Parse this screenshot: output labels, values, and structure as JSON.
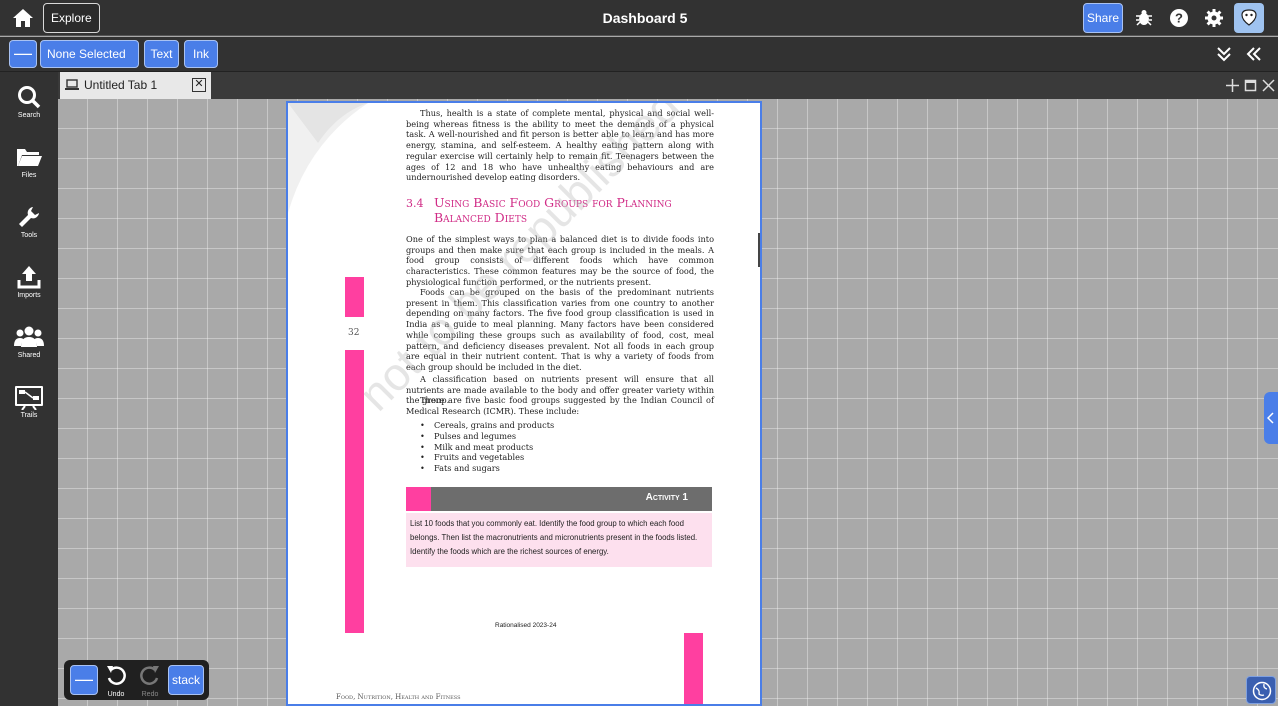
{
  "topbar": {
    "explore_label": "Explore",
    "title": "Dashboard 5",
    "share_label": "Share",
    "icons": [
      "home-icon",
      "bug-icon",
      "help-icon",
      "gear-icon",
      "avatar-icon"
    ]
  },
  "toolbar": {
    "minus_label": "—",
    "selection_label": "None Selected",
    "text_label": "Text",
    "ink_label": "Ink"
  },
  "sidebar": {
    "items": [
      {
        "label": "Search",
        "icon": "search-icon"
      },
      {
        "label": "Files",
        "icon": "folder-icon"
      },
      {
        "label": "Tools",
        "icon": "wrench-icon"
      },
      {
        "label": "Imports",
        "icon": "upload-icon"
      },
      {
        "label": "Shared",
        "icon": "users-icon"
      },
      {
        "label": "Trails",
        "icon": "trails-icon"
      }
    ]
  },
  "tabs": [
    {
      "label": "Untitled Tab 1",
      "close": "✕"
    }
  ],
  "document": {
    "para_intro": "Thus, health is a state of complete mental, physical and social well-being whereas fitness is the ability to meet the demands of a physical task. A well-nourished and fit person is better able to learn and has more energy, stamina, and self-esteem. A healthy eating pattern along with regular exercise will certainly help to remain fit. Teenagers between the ages of 12 and 18 who have unhealthy eating behaviours and are undernourished develop eating disorders.",
    "section_number": "3.4",
    "section_title": "Using Basic Food Groups for Planning Balanced Diets",
    "para_1": "One of the simplest ways to plan a balanced diet is to divide foods into groups and then make sure that each group is included in the meals. A food group consists of different foods which have common characteristics. These common features may be the source of food, the physiological function performed, or the nutrients present.",
    "para_2": "Foods can be grouped on the basis of the predominant nutrients present in them. This classification varies from one country to another depending on many factors. The five food group classification is used in India as a guide to meal planning. Many factors have been considered while compiling these groups such as availability of food, cost, meal pattern, and deficiency diseases prevalent. Not all foods in each group are equal in their nutrient content. That is why a variety of foods from each group should be included in the diet.",
    "para_3": "A classification based on nutrients present will ensure that all nutrients are made available to the body and offer greater variety within the group.",
    "para_4": "There are five basic food groups suggested by the Indian Council of Medical Research (ICMR). These include:",
    "bullets": [
      "Cereals, grains and products",
      "Pulses and legumes",
      "Milk and meat products",
      "Fruits and vegetables",
      "Fats and sugars"
    ],
    "activity_title": "Activity 1",
    "activity_text": "List 10 foods that you commonly eat. Identify the food group to which each food belongs. Then list the macronutrients and micronutrients present in the foods listed. Identify the foods which are the richest sources of energy.",
    "page_number": "32",
    "footer_rationalised": "Rationalised 2023-24",
    "footer_book": "Food, Nutrition, Health and Fitness",
    "watermark": "not to be republished"
  },
  "bottom": {
    "minus_label": "—",
    "undo_label": "Undo",
    "redo_label": "Redo",
    "stack_label": "stack"
  },
  "colors": {
    "accent": "#4a7ee8",
    "pink": "#ff3fa0",
    "section_pink": "#d02b86",
    "dark": "#323232"
  }
}
